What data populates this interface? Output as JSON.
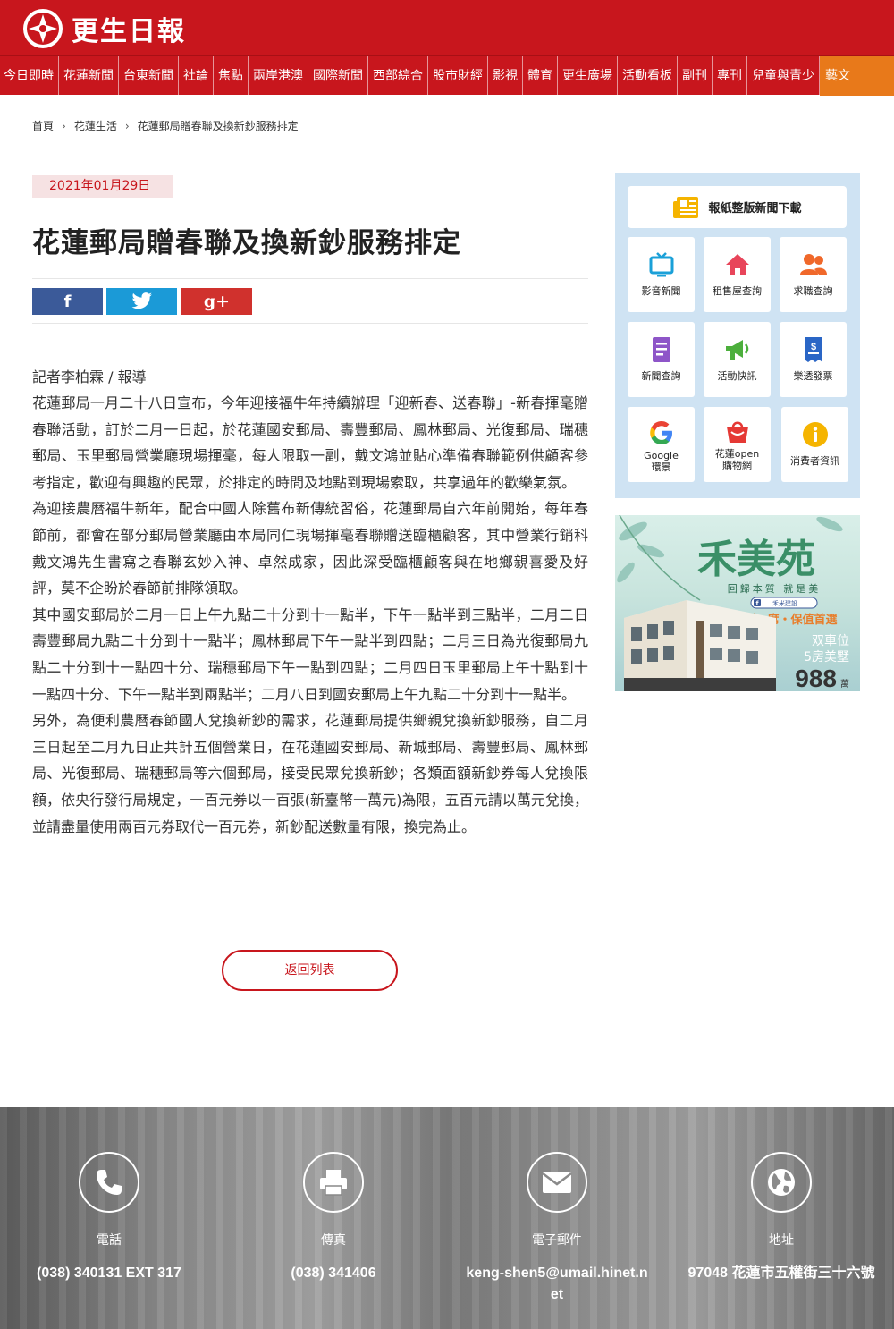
{
  "header": {
    "logo_text": "更生日報",
    "nav": [
      "今日即時",
      "花蓮新聞",
      "台東新聞",
      "社論",
      "焦點",
      "兩岸港澳",
      "國際新聞",
      "西部綜合",
      "股市財經",
      "影視",
      "體育",
      "更生廣場",
      "活動看板",
      "副刊",
      "專刊",
      "兒童與青少",
      "藝文"
    ],
    "accent_color": "#c8161d",
    "active_tab_color": "#e8791a"
  },
  "breadcrumb": [
    "首頁",
    "花蓮生活",
    "花蓮郵局贈春聯及換新鈔服務排定"
  ],
  "article": {
    "date": "2021年01月29日",
    "title": "花蓮郵局贈春聯及換新鈔服務排定",
    "byline": "記者李柏霖 / 報導",
    "paragraphs": [
      "花蓮郵局一月二十八日宣布，今年迎接福牛年持續辦理「迎新春、送春聯」-新春揮毫贈春聯活動，訂於二月一日起，於花蓮國安郵局、壽豐郵局、鳳林郵局、光復郵局、瑞穗郵局、玉里郵局營業廳現場揮毫，每人限取一副，戴文鴻並貼心準備春聯範例供顧客參考指定，歡迎有興趣的民眾，於排定的時間及地點到現場索取，共享過年的歡樂氣氛。",
      "為迎接農曆福牛新年，配合中國人除舊布新傳統習俗，花蓮郵局自六年前開始，每年春節前，都會在部分郵局營業廳由本局同仁現場揮毫春聯贈送臨櫃顧客，其中營業行銷科戴文鴻先生書寫之春聯玄妙入神、卓然成家，因此深受臨櫃顧客與在地鄉親喜愛及好評，莫不企盼於春節前排隊領取。",
      "其中國安郵局於二月一日上午九點二十分到十一點半，下午一點半到三點半，二月二日壽豐郵局九點二十分到十一點半；鳳林郵局下午一點半到四點；二月三日為光復郵局九點二十分到十一點四十分、瑞穗郵局下午一點到四點；二月四日玉里郵局上午十點到十一點四十分、下午一點半到兩點半；二月八日到國安郵局上午九點二十分到十一點半。",
      "另外，為便利農曆春節國人兌換新鈔的需求，花蓮郵局提供鄉親兌換新鈔服務，自二月三日起至二月九日止共計五個營業日，在花蓮國安郵局、新城郵局、壽豐郵局、鳳林郵局、光復郵局、瑞穗郵局等六個郵局，接受民眾兌換新鈔；各類面額新鈔券每人兌換限額，依央行發行局規定，一百元券以一百張(新臺幣一萬元)為限，五百元請以萬元兌換，並請盡量使用兩百元券取代一百元券，新鈔配送數量有限，換完為止。"
    ],
    "back_button": "返回列表"
  },
  "share": {
    "facebook": "f",
    "google_plus": "g+"
  },
  "sidebar": {
    "download_label": "報紙整版新聞下載",
    "tiles": [
      {
        "label": "影音新聞",
        "icon": "tv-icon",
        "color": "#1aa0d8"
      },
      {
        "label": "租售屋查詢",
        "icon": "home-icon",
        "color": "#e8455a"
      },
      {
        "label": "求職查詢",
        "icon": "people-icon",
        "color": "#f0682a"
      },
      {
        "label": "新聞查詢",
        "icon": "document-icon",
        "color": "#8e55c8"
      },
      {
        "label": "活動快訊",
        "icon": "megaphone-icon",
        "color": "#4caf3c"
      },
      {
        "label": "樂透發票",
        "icon": "receipt-icon",
        "color": "#2a66c6"
      },
      {
        "label": "Google\n環景",
        "icon": "google-icon",
        "color": "#4285f4"
      },
      {
        "label": "花蓮open\n購物網",
        "icon": "shopping-bag-icon",
        "color": "#e53935"
      },
      {
        "label": "消費者資訊",
        "icon": "info-icon",
        "color": "#f5b400"
      }
    ],
    "ad": {
      "brand": "禾美苑",
      "slogan": "回歸本質 就是美",
      "fb_tag": "禾米建設",
      "highlight": "僅剩一席・保值首選",
      "feature_1": "双車位",
      "feature_2": "5房美墅",
      "price": "988",
      "price_unit": "萬"
    }
  },
  "footer": {
    "contacts": [
      {
        "label": "電話",
        "value": "(038) 340131 EXT 317",
        "icon": "phone-icon"
      },
      {
        "label": "傳真",
        "value": "(038) 341406",
        "icon": "fax-icon"
      },
      {
        "label": "電子郵件",
        "value": "keng-shen5@umail.hinet.net",
        "icon": "mail-icon"
      },
      {
        "label": "地址",
        "value": "97048 花蓮市五權街三十六號",
        "icon": "globe-icon"
      }
    ]
  }
}
